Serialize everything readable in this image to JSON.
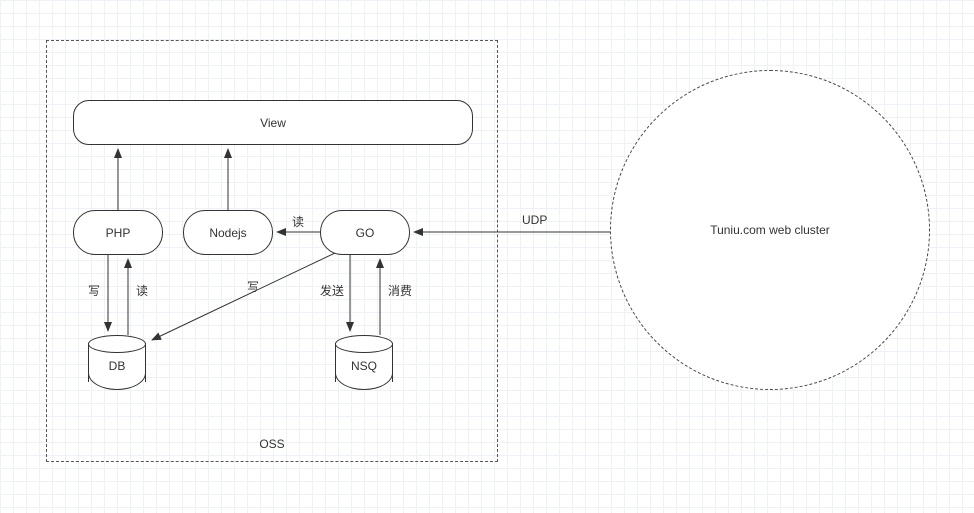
{
  "container": {
    "oss_label": "OSS"
  },
  "nodes": {
    "view": "View",
    "php": "PHP",
    "nodejs": "Nodejs",
    "go": "GO",
    "db": "DB",
    "nsq": "NSQ",
    "cluster": "Tuniu.com web cluster"
  },
  "edges": {
    "go_to_nodejs": "读",
    "php_db_write": "写",
    "php_db_read": "读",
    "go_to_db_write": "写",
    "go_nsq_send": "发送",
    "go_nsq_consume": "消费",
    "cluster_to_go": "UDP"
  }
}
